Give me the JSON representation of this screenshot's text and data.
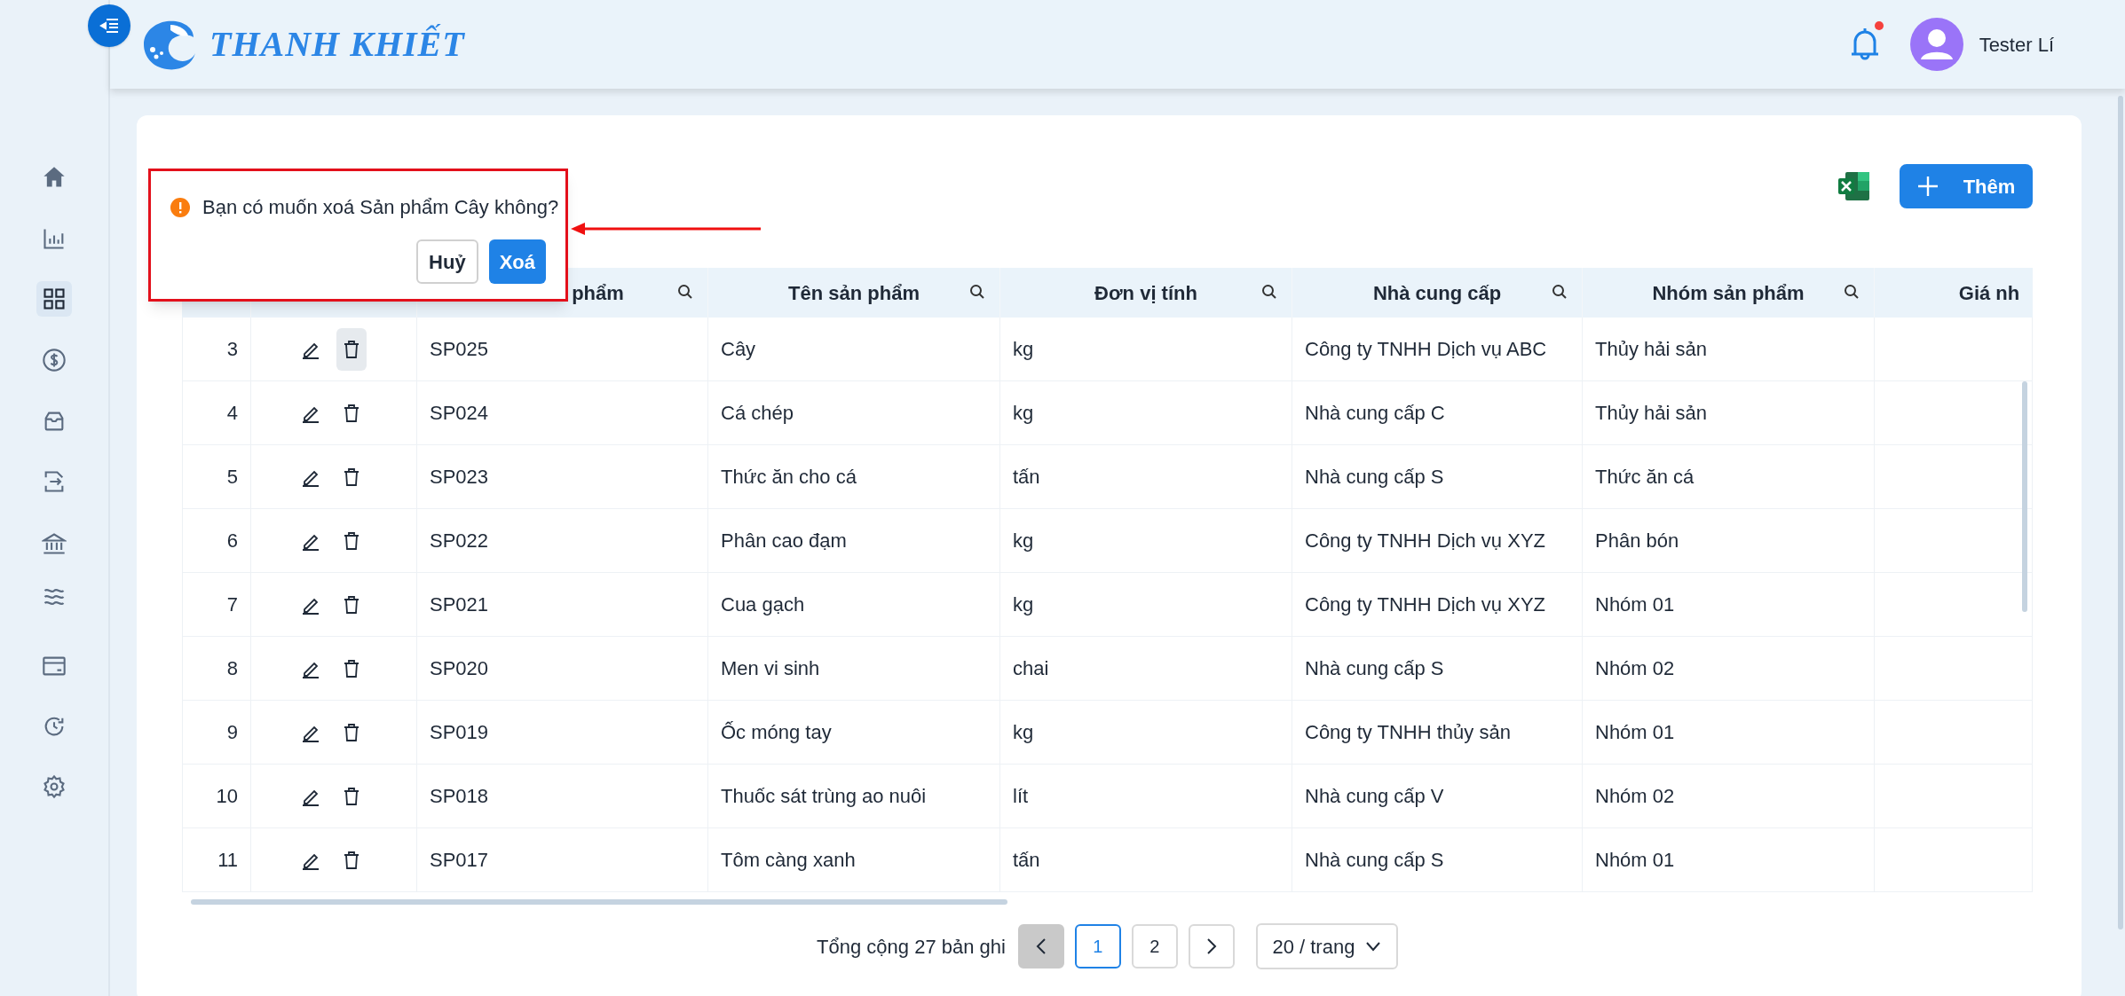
{
  "header": {
    "brand": "THANH KHIẾT",
    "notifications": {
      "unread": true
    },
    "user": {
      "name": "Tester Lí"
    }
  },
  "sidebar": {
    "items": [
      {
        "kind": "home",
        "selected": false
      },
      {
        "kind": "chart",
        "selected": false
      },
      {
        "kind": "grid",
        "selected": true
      },
      {
        "kind": "dollar",
        "selected": false
      },
      {
        "kind": "inbox",
        "selected": false
      },
      {
        "kind": "transfer",
        "selected": false
      },
      {
        "kind": "bank",
        "selected": false
      },
      {
        "kind": "waves",
        "selected": false
      },
      {
        "kind": "card",
        "selected": false
      },
      {
        "kind": "history",
        "selected": false
      },
      {
        "kind": "settings",
        "selected": false
      }
    ]
  },
  "toolbar": {
    "add_button": "Thêm"
  },
  "table": {
    "columns": [
      {
        "label": "phẩm",
        "searchable": true
      },
      {
        "label": "Tên sản phẩm",
        "searchable": true
      },
      {
        "label": "Đơn vị tính",
        "searchable": true
      },
      {
        "label": "Nhà cung cấp",
        "searchable": true
      },
      {
        "label": "Nhóm sản phẩm",
        "searchable": true
      },
      {
        "label": "Giá nh",
        "searchable": false
      }
    ],
    "rows": [
      {
        "stt": "3",
        "code": "SP025",
        "name": "Cây",
        "unit": "kg",
        "supplier": "Công ty TNHH Dịch vụ ABC",
        "group": "Thủy hải sản",
        "delete_highlighted": true
      },
      {
        "stt": "4",
        "code": "SP024",
        "name": "Cá chép",
        "unit": "kg",
        "supplier": "Nhà cung cấp C",
        "group": "Thủy hải sản",
        "delete_highlighted": false
      },
      {
        "stt": "5",
        "code": "SP023",
        "name": "Thức ăn cho cá",
        "unit": "tấn",
        "supplier": "Nhà cung cấp S",
        "group": "Thức ăn cá",
        "delete_highlighted": false
      },
      {
        "stt": "6",
        "code": "SP022",
        "name": "Phân cao đạm",
        "unit": "kg",
        "supplier": "Công ty TNHH Dịch vụ XYZ",
        "group": "Phân bón",
        "delete_highlighted": false
      },
      {
        "stt": "7",
        "code": "SP021",
        "name": "Cua gạch",
        "unit": "kg",
        "supplier": "Công ty TNHH Dịch vụ XYZ",
        "group": "Nhóm 01",
        "delete_highlighted": false
      },
      {
        "stt": "8",
        "code": "SP020",
        "name": "Men vi sinh",
        "unit": "chai",
        "supplier": "Nhà cung cấp S",
        "group": "Nhóm 02",
        "delete_highlighted": false
      },
      {
        "stt": "9",
        "code": "SP019",
        "name": "Ốc móng tay",
        "unit": "kg",
        "supplier": "Công ty TNHH thủy sản",
        "group": "Nhóm 01",
        "delete_highlighted": false
      },
      {
        "stt": "10",
        "code": "SP018",
        "name": "Thuốc sát trùng ao nuôi",
        "unit": "lít",
        "supplier": "Nhà cung cấp V",
        "group": "Nhóm 02",
        "delete_highlighted": false
      },
      {
        "stt": "11",
        "code": "SP017",
        "name": "Tôm càng xanh",
        "unit": "tấn",
        "supplier": "Nhà cung cấp S",
        "group": "Nhóm 01",
        "delete_highlighted": false
      }
    ]
  },
  "popconfirm": {
    "message": "Bạn có muốn xoá Sản phẩm Cây không?",
    "cancel": "Huỷ",
    "confirm": "Xoá"
  },
  "pagination": {
    "total": "Tổng cộng 27 bản ghi",
    "prev_disabled": true,
    "pages": [
      {
        "label": "1",
        "selected": true
      },
      {
        "label": "2",
        "selected": false
      }
    ],
    "page_size": "20 / trang"
  }
}
